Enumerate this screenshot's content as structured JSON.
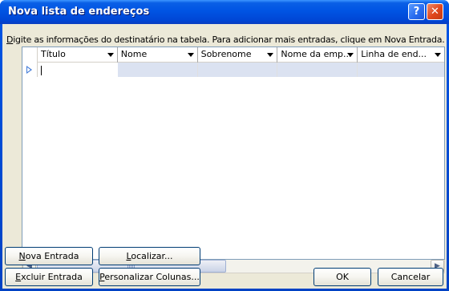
{
  "window": {
    "title": "Nova lista de endereços",
    "help_label": "?",
    "close_label": "✕"
  },
  "instruction": {
    "accel": "D",
    "rest": "igite as informações do destinatário na tabela. Para adicionar mais entradas, clique em Nova Entrada."
  },
  "grid": {
    "columns": [
      {
        "label": "Título"
      },
      {
        "label": "Nome"
      },
      {
        "label": "Sobrenome"
      },
      {
        "label": "Nome da emp..."
      },
      {
        "label": "Linha de end..."
      }
    ],
    "row_value": ""
  },
  "scrollbar": {
    "left_arrow": "◀",
    "right_arrow": "▶"
  },
  "buttons": {
    "new_entry": {
      "accel": "N",
      "rest": "ova Entrada"
    },
    "find": {
      "accel": "L",
      "rest": "ocalizar..."
    },
    "delete_entry": {
      "accel": "E",
      "rest": "xcluir Entrada"
    },
    "customize": {
      "accel": "P",
      "rest": "ersonalizar Colunas..."
    },
    "ok": "OK",
    "cancel": "Cancelar"
  }
}
